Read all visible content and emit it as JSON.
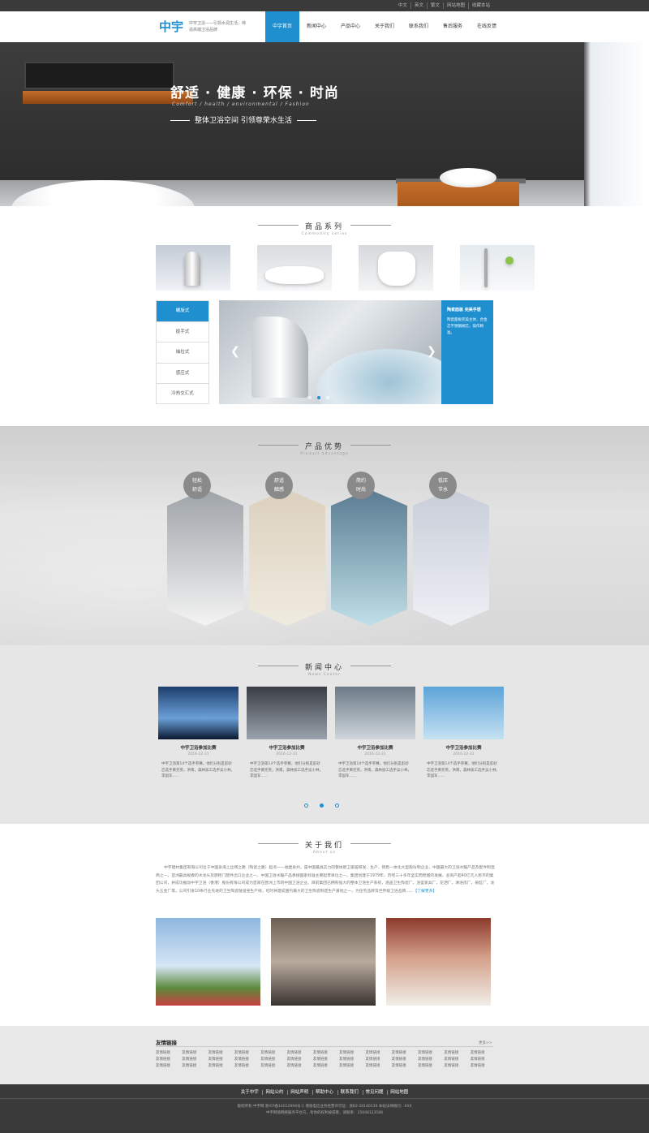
{
  "topbar": {
    "links": [
      "中文",
      "英文",
      "繁文",
      "网站地图",
      "收藏本站"
    ]
  },
  "header": {
    "logo": "中宇",
    "slogan": "中宇卫浴——引领水润生活，缔造高端卫浴品牌",
    "nav": [
      "中宇首页",
      "新闻中心",
      "产品中心",
      "关于我们",
      "联系我们",
      "售后服务",
      "在线反馈"
    ]
  },
  "banner": {
    "title": "舒适 · 健康 · 环保 · 时尚",
    "subtitle": "Comfort / health / environmental / Fashion",
    "tagline": "整体卫浴空间  引领尊荣水生活"
  },
  "products": {
    "title_cn": "商品系列",
    "title_en": "Commodity series",
    "tabs": [
      "螺旋式",
      "扳手式",
      "抽拉式",
      "感应式",
      "冷热交汇式"
    ],
    "info_title": "陶瓷面板 完美手感",
    "info_text": "陶瓷面板完美主体，合金芯不锈钢阀芯，操作精准。"
  },
  "advantages": {
    "title_cn": "产品优势",
    "title_en": "Product advantage",
    "items": [
      {
        "line1": "轻松",
        "line2": "舒适"
      },
      {
        "line1": "舒适",
        "line2": "触感"
      },
      {
        "line1": "简约",
        "line2": "时尚"
      },
      {
        "line1": "低压",
        "line2": "节水"
      }
    ]
  },
  "news": {
    "title_cn": "新闻中心",
    "title_en": "News Center",
    "items": [
      {
        "title": "中宇卫浴参加比赛",
        "date": "2016-12-31",
        "text": "中宇卫浴第14个选手参赛，他们分别是彭砂芯选手黄宪英，洪南，森林加工选手吴小林，李国军......"
      },
      {
        "title": "中宇卫浴参加比赛",
        "date": "2016-12-31",
        "text": "中宇卫浴第14个选手参赛，他们分别是彭砂芯选手黄宪英，洪南，森林加工选手吴小林，李国军......"
      },
      {
        "title": "中宇卫浴参加比赛",
        "date": "2016-12-31",
        "text": "中宇卫浴第14个选手参赛，他们分别是彭砂芯选手黄宪英，洪南，森林加工选手吴小林，李国军......"
      },
      {
        "title": "中宇卫浴参加比赛",
        "date": "2016-12-31",
        "text": "中宇卫浴第14个选手参赛，他们分别是彭砂芯选手黄宪英，洪南，森林加工选手吴小林，李国军......"
      }
    ]
  },
  "about": {
    "title_cn": "关于我们",
    "title_en": "About us",
    "text": "中宇建材集团有限公司位于中国泉海上丝绸之路（陶瓷之路）起点——福建泉州，是中国最具实力的整体厨卫家居研发、生产、销售一体化大型股份制企业，中国最大的卫浴水暖产品及配件制造商之一，亚洲最具规模的水龙头及厨柜门配件出口企业之一，中国卫浴水暖产品承接国家标准主要起草单位之一。集团创建于1979年，历经三十多年坚实而稳健的发展，总资产超40亿元人民币的集团公司，并成功推动中宇卫浴（香港）股份有限公司成为首家在欧洲上市的中国卫浴企业。目前集团已拥有强大的整体卫浴生产系统，涵盖卫生陶瓷厂，浴室家具厂，花洒厂，淋浴房厂，染缸厂，龙头五金厂等，公司引进10条行业先进的卫生陶瓷隧道窑生产线，屹时将建成国内最大的卫生陶瓷制造生产基地之一，为住宅品牌及世界级卫浴品牌......",
    "more": "【了解更多】"
  },
  "friends": {
    "title": "友情链接",
    "more": "更多>>",
    "links": [
      "友情链接",
      "友情链接",
      "友情链接",
      "友情链接",
      "友情链接",
      "友情链接",
      "友情链接",
      "友情链接",
      "友情链接",
      "友情链接",
      "友情链接",
      "友情链接",
      "友情链接",
      "友情链接",
      "友情链接",
      "友情链接",
      "友情链接",
      "友情链接",
      "友情链接",
      "友情链接",
      "友情链接",
      "友情链接",
      "友情链接",
      "友情链接",
      "友情链接",
      "友情链接",
      "友情链接",
      "友情链接",
      "友情链接",
      "友情链接",
      "友情链接",
      "友情链接",
      "友情链接",
      "友情链接",
      "友情链接",
      "友情链接",
      "友情链接",
      "友情链接",
      "友情链接"
    ]
  },
  "footer": {
    "nav": [
      "关于中宇",
      "网站公约",
      "网站声明",
      "帮助中心",
      "联系我们",
      "常见问题",
      "网站地图"
    ],
    "copy1": "版权所有:中宇网  浙ICP备14012994号-1  增值电信业务经营许可证：浙B2-20140130  本站法律顾问：XXX",
    "copy2": "中宇网值网络服务平台方，有你的权利被侵害，请联系：15648123588"
  },
  "colors": {
    "accent": "#1f8fd0",
    "footer_bg": "#3a3a3a"
  }
}
